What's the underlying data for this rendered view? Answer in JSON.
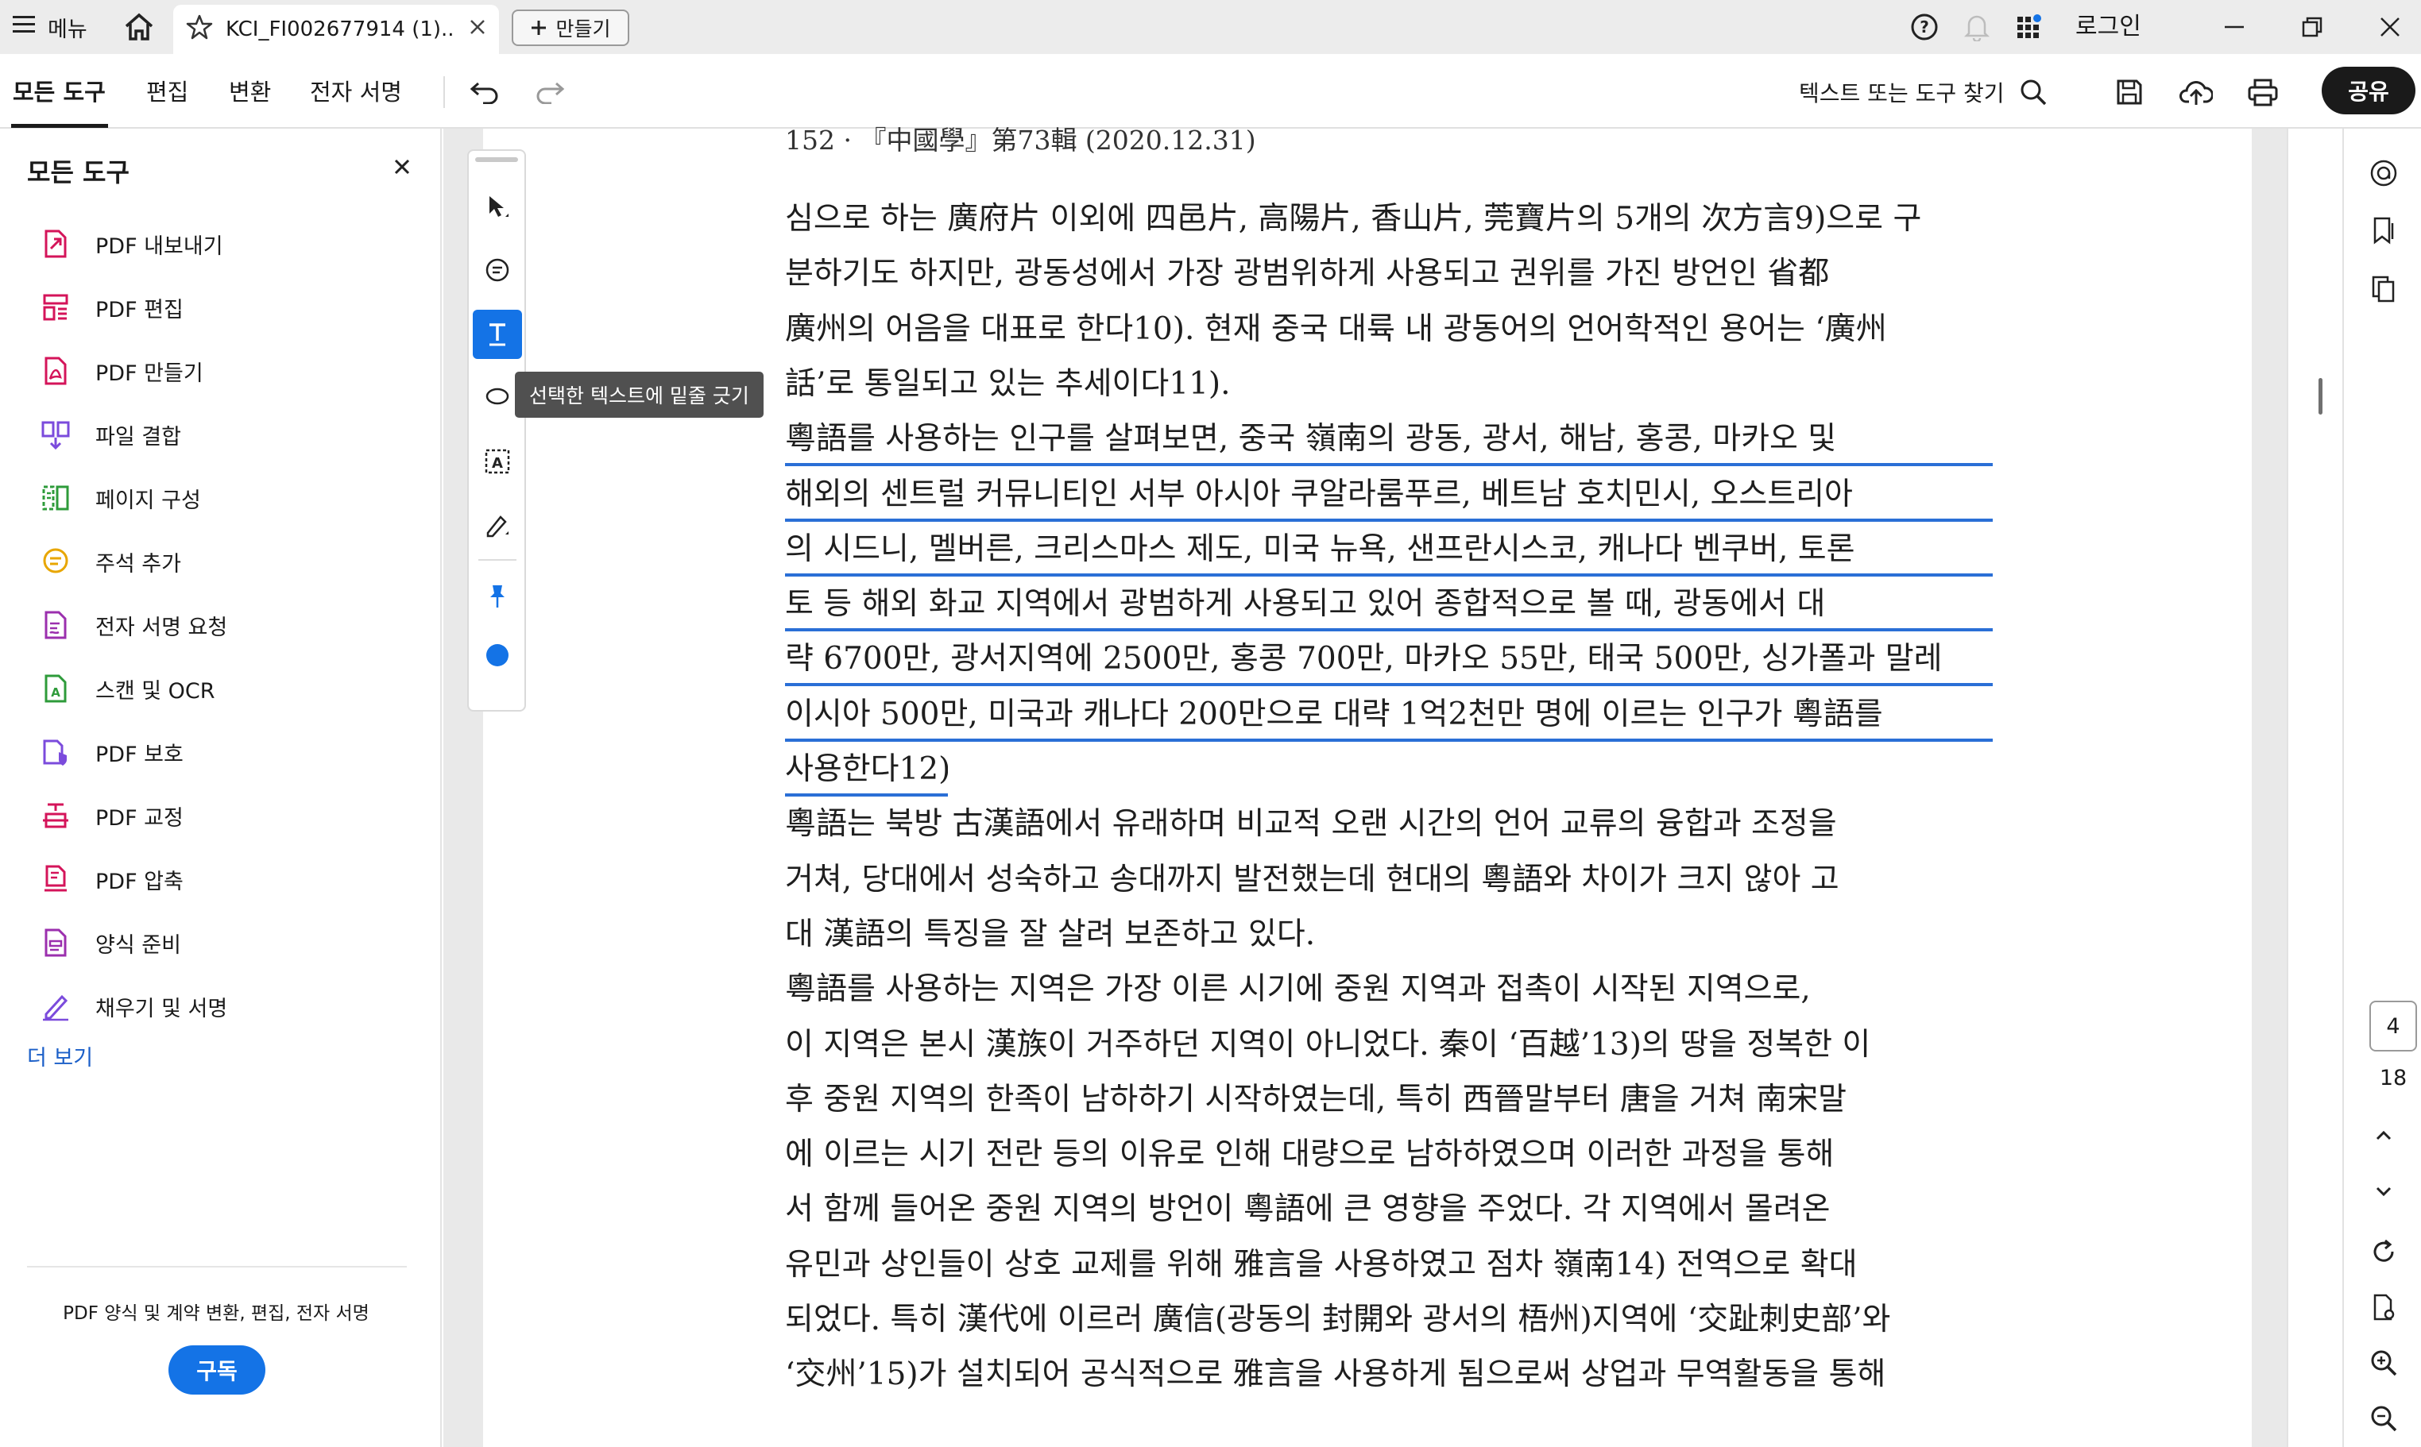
{
  "titlebar": {
    "menu_label": "메뉴",
    "tab_title": "KCI_FI002677914 (1)....",
    "new_tab_label": "만들기",
    "login_label": "로그인"
  },
  "toolbar": {
    "tabs": [
      "모든 도구",
      "편집",
      "변환",
      "전자 서명"
    ],
    "search_label": "텍스트 또는 도구 찾기",
    "share_label": "공유"
  },
  "left_panel": {
    "title": "모든 도구",
    "items": [
      {
        "label": "PDF 내보내기",
        "icon": "export-pdf-icon",
        "color": "#d4145a"
      },
      {
        "label": "PDF 편집",
        "icon": "edit-pdf-icon",
        "color": "#d4145a"
      },
      {
        "label": "PDF 만들기",
        "icon": "create-pdf-icon",
        "color": "#d4145a"
      },
      {
        "label": "파일 결합",
        "icon": "combine-files-icon",
        "color": "#7b4bdc"
      },
      {
        "label": "페이지 구성",
        "icon": "organize-pages-icon",
        "color": "#2e9b3a"
      },
      {
        "label": "주석 추가",
        "icon": "comment-icon",
        "color": "#e8a600"
      },
      {
        "label": "전자 서명 요청",
        "icon": "request-esign-icon",
        "color": "#9b2fae"
      },
      {
        "label": "스캔 및 OCR",
        "icon": "scan-ocr-icon",
        "color": "#2e9b3a"
      },
      {
        "label": "PDF 보호",
        "icon": "protect-pdf-icon",
        "color": "#7b4bdc"
      },
      {
        "label": "PDF 교정",
        "icon": "redact-pdf-icon",
        "color": "#d4145a"
      },
      {
        "label": "PDF 압축",
        "icon": "compress-pdf-icon",
        "color": "#d4145a"
      },
      {
        "label": "양식 준비",
        "icon": "prepare-form-icon",
        "color": "#9b2fae"
      },
      {
        "label": "채우기 및 서명",
        "icon": "fill-sign-icon",
        "color": "#7b4bdc"
      }
    ],
    "more_label": "더 보기",
    "promo_text": "PDF 양식 및 계약 변환, 편집, 전자 서명",
    "subscribe_label": "구독"
  },
  "quick_tools": {
    "tooltip": "선택한 텍스트에 밑줄 긋기",
    "active_color": "#1473e6",
    "color_dot": "#1473e6"
  },
  "document": {
    "header": "152 · 『中國學』第73輯 (2020.12.31)",
    "lines": [
      {
        "text": "심으로 하는 廣府片 이외에 四邑片, 高陽片, 香山片, 莞寶片의 5개의 次方言9)으로 구",
        "highlight": false
      },
      {
        "text": "분하기도 하지만, 광동성에서 가장 광범위하게 사용되고 권위를 가진 방언인 省都",
        "highlight": false
      },
      {
        "text": "廣州의 어음을 대표로 한다10). 현재 중국 대륙 내 광동어의 언어학적인 용어는 ‘廣州",
        "highlight": false
      },
      {
        "text": "話’로 통일되고 있는 추세이다11).",
        "highlight": false
      },
      {
        "text": "  粵語를 사용하는 인구를 살펴보면, 중국 嶺南의 광동, 광서, 해남, 홍콩, 마카오 및",
        "highlight": true
      },
      {
        "text": "해외의 센트럴 커뮤니티인 서부 아시아 쿠알라룸푸르, 베트남 호치민시, 오스트리아",
        "highlight": true
      },
      {
        "text": "의 시드니, 멜버른, 크리스마스 제도, 미국 뉴욕, 샌프란시스코, 캐나다 벤쿠버, 토론",
        "highlight": true
      },
      {
        "text": "토 등 해외 화교 지역에서 광범하게 사용되고 있어 종합적으로 볼 때, 광동에서 대",
        "highlight": true
      },
      {
        "text": "략 6700만, 광서지역에 2500만, 홍콩 700만, 마카오 55만, 태국 500만, 싱가폴과 말레",
        "highlight": true
      },
      {
        "text": "이시아 500만, 미국과 캐나다 200만으로 대략 1억2천만 명에 이르는 인구가 粵語를",
        "highlight": true
      },
      {
        "text": "사용한다12).",
        "highlight": true,
        "partial": true
      },
      {
        "text": "  粵語는 북방 古漢語에서 유래하며 비교적 오랜 시간의 언어 교류의 융합과 조정을",
        "highlight": false
      },
      {
        "text": "거쳐, 당대에서 성숙하고 송대까지 발전했는데 현대의 粵語와 차이가 크지 않아 고",
        "highlight": false
      },
      {
        "text": "대 漢語의 특징을 잘 살려 보존하고 있다.",
        "highlight": false
      },
      {
        "text": "  粵語를 사용하는 지역은 가장 이른 시기에 중원 지역과 접촉이 시작된 지역으로,",
        "highlight": false
      },
      {
        "text": "이 지역은 본시 漢族이 거주하던 지역이 아니었다. 秦이 ‘百越’13)의 땅을 정복한 이",
        "highlight": false
      },
      {
        "text": "후 중원 지역의 한족이 남하하기 시작하였는데, 특히 西晉말부터 唐을 거쳐 南宋말",
        "highlight": false
      },
      {
        "text": "에 이르는 시기 전란 등의 이유로 인해 대량으로 남하하였으며 이러한 과정을 통해",
        "highlight": false
      },
      {
        "text": "서 함께 들어온 중원 지역의 방언이 粵語에 큰 영향을 주었다. 각 지역에서 몰려온",
        "highlight": false
      },
      {
        "text": "유민과 상인들이 상호 교제를 위해 雅言을 사용하였고 점차 嶺南14) 전역으로 확대",
        "highlight": false
      },
      {
        "text": "되었다. 특히 漢代에 이르러 廣信(광동의 封開와 광서의 梧州)지역에 ‘交趾刺史部’와",
        "highlight": false
      },
      {
        "text": "‘交州’15)가 설치되어 공식적으로 雅言을 사용하게 됨으로써 상업과 무역활동을 통해",
        "highlight": false
      }
    ]
  },
  "navigation": {
    "current_page": "4",
    "total_pages": "18"
  }
}
